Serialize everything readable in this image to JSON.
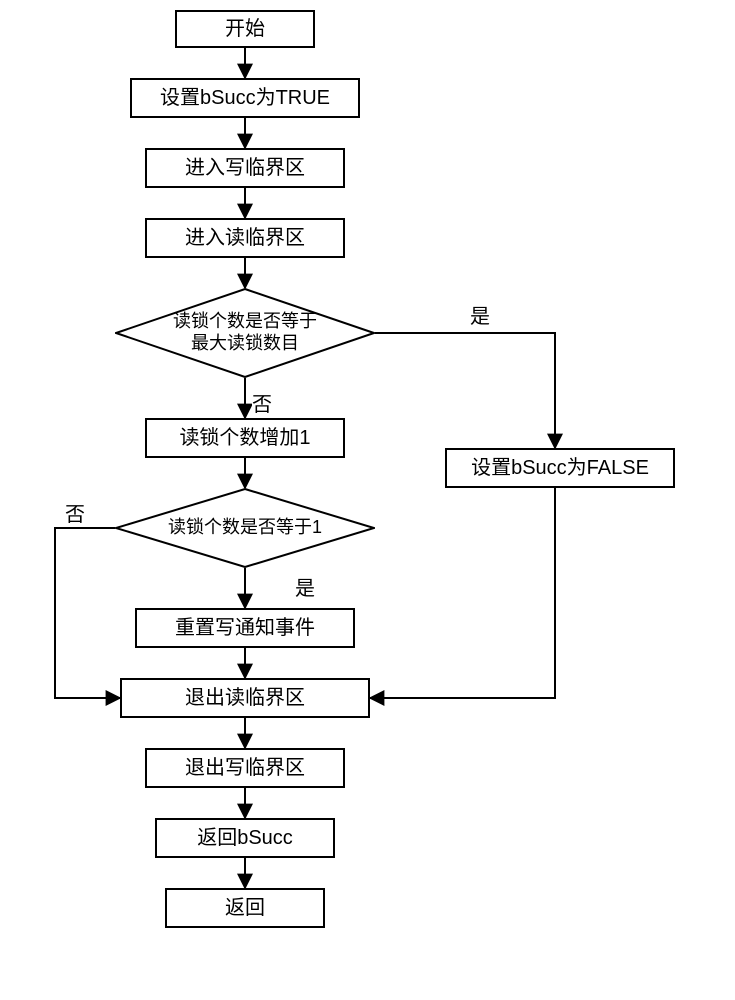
{
  "nodes": {
    "start": "开始",
    "set_true": "设置bSucc为TRUE",
    "enter_write": "进入写临界区",
    "enter_read": "进入读临界区",
    "dec_readmax": "读锁个数是否等于\n最大读锁数目",
    "inc_read": "读锁个数增加1",
    "set_false": "设置bSucc为FALSE",
    "dec_read1": "读锁个数是否等于1",
    "reset_event": "重置写通知事件",
    "exit_read": "退出读临界区",
    "exit_write": "退出写临界区",
    "return_bsucc": "返回bSucc",
    "return": "返回"
  },
  "labels": {
    "yes": "是",
    "no": "否"
  },
  "chart_data": {
    "type": "flowchart",
    "nodes": [
      {
        "id": "start",
        "shape": "rect",
        "text": "开始"
      },
      {
        "id": "set_true",
        "shape": "rect",
        "text": "设置bSucc为TRUE"
      },
      {
        "id": "enter_write",
        "shape": "rect",
        "text": "进入写临界区"
      },
      {
        "id": "enter_read",
        "shape": "rect",
        "text": "进入读临界区"
      },
      {
        "id": "dec_readmax",
        "shape": "diamond",
        "text": "读锁个数是否等于最大读锁数目"
      },
      {
        "id": "inc_read",
        "shape": "rect",
        "text": "读锁个数增加1"
      },
      {
        "id": "set_false",
        "shape": "rect",
        "text": "设置bSucc为FALSE"
      },
      {
        "id": "dec_read1",
        "shape": "diamond",
        "text": "读锁个数是否等于1"
      },
      {
        "id": "reset_event",
        "shape": "rect",
        "text": "重置写通知事件"
      },
      {
        "id": "exit_read",
        "shape": "rect",
        "text": "退出读临界区"
      },
      {
        "id": "exit_write",
        "shape": "rect",
        "text": "退出写临界区"
      },
      {
        "id": "return_bsucc",
        "shape": "rect",
        "text": "返回bSucc"
      },
      {
        "id": "return",
        "shape": "rect",
        "text": "返回"
      }
    ],
    "edges": [
      {
        "from": "start",
        "to": "set_true"
      },
      {
        "from": "set_true",
        "to": "enter_write"
      },
      {
        "from": "enter_write",
        "to": "enter_read"
      },
      {
        "from": "enter_read",
        "to": "dec_readmax"
      },
      {
        "from": "dec_readmax",
        "to": "set_false",
        "label": "是"
      },
      {
        "from": "dec_readmax",
        "to": "inc_read",
        "label": "否"
      },
      {
        "from": "inc_read",
        "to": "dec_read1"
      },
      {
        "from": "dec_read1",
        "to": "reset_event",
        "label": "是"
      },
      {
        "from": "dec_read1",
        "to": "exit_read",
        "label": "否"
      },
      {
        "from": "reset_event",
        "to": "exit_read"
      },
      {
        "from": "set_false",
        "to": "exit_read"
      },
      {
        "from": "exit_read",
        "to": "exit_write"
      },
      {
        "from": "exit_write",
        "to": "return_bsucc"
      },
      {
        "from": "return_bsucc",
        "to": "return"
      }
    ]
  }
}
